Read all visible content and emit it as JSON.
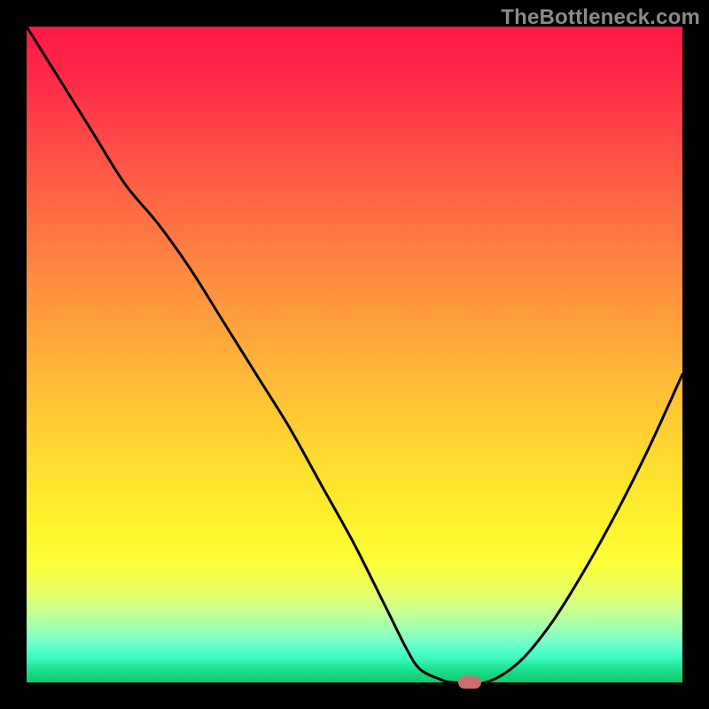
{
  "watermark": "TheBottleneck.com",
  "chart_data": {
    "type": "line",
    "title": "",
    "xlabel": "",
    "ylabel": "",
    "xlim": [
      0,
      100
    ],
    "ylim": [
      0,
      100
    ],
    "grid": false,
    "x": [
      0,
      5,
      10,
      15,
      20,
      25,
      30,
      35,
      40,
      45,
      50,
      55,
      58,
      60,
      63,
      65,
      70,
      75,
      80,
      85,
      90,
      95,
      100
    ],
    "values": [
      100,
      92,
      84,
      76,
      70,
      63,
      55,
      47,
      39,
      30,
      21,
      11,
      5,
      2,
      0.5,
      0,
      0,
      3,
      9,
      17,
      26,
      36,
      47
    ],
    "marker": {
      "x": 67.5,
      "y": 0
    },
    "gradient_stops": [
      {
        "pos": 0,
        "color": "#ff1846"
      },
      {
        "pos": 0.5,
        "color": "#ffb836"
      },
      {
        "pos": 0.8,
        "color": "#fcff3a"
      },
      {
        "pos": 1.0,
        "color": "#0fca6e"
      }
    ]
  }
}
